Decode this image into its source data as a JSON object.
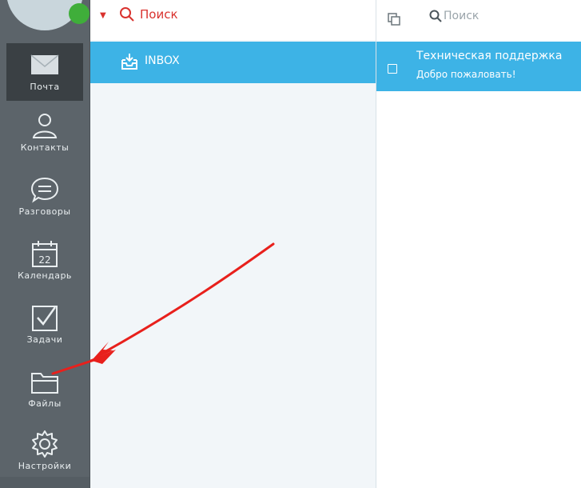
{
  "sidebar": {
    "items": [
      {
        "label": "Почта",
        "icon": "mail-icon"
      },
      {
        "label": "Контакты",
        "icon": "contacts-icon"
      },
      {
        "label": "Разговоры",
        "icon": "chat-icon"
      },
      {
        "label": "Календарь",
        "icon": "calendar-icon",
        "day": "22"
      },
      {
        "label": "Задачи",
        "icon": "tasks-icon"
      },
      {
        "label": "Файлы",
        "icon": "folder-icon"
      },
      {
        "label": "Настройки",
        "icon": "settings-icon"
      }
    ]
  },
  "folders": {
    "search_label": "Поиск",
    "items": [
      {
        "label": "INBOX",
        "icon": "inbox-icon"
      }
    ]
  },
  "messages": {
    "search_label": "Поиск",
    "items": [
      {
        "sender": "Техническая поддержка",
        "subject": "Добро пожаловать!"
      }
    ]
  },
  "colors": {
    "sidebar": "#5c646a",
    "accent": "#3db3e6",
    "search_red": "#d9322e",
    "status_green": "#3fae3a",
    "annotation_arrow": "#e8201c"
  }
}
